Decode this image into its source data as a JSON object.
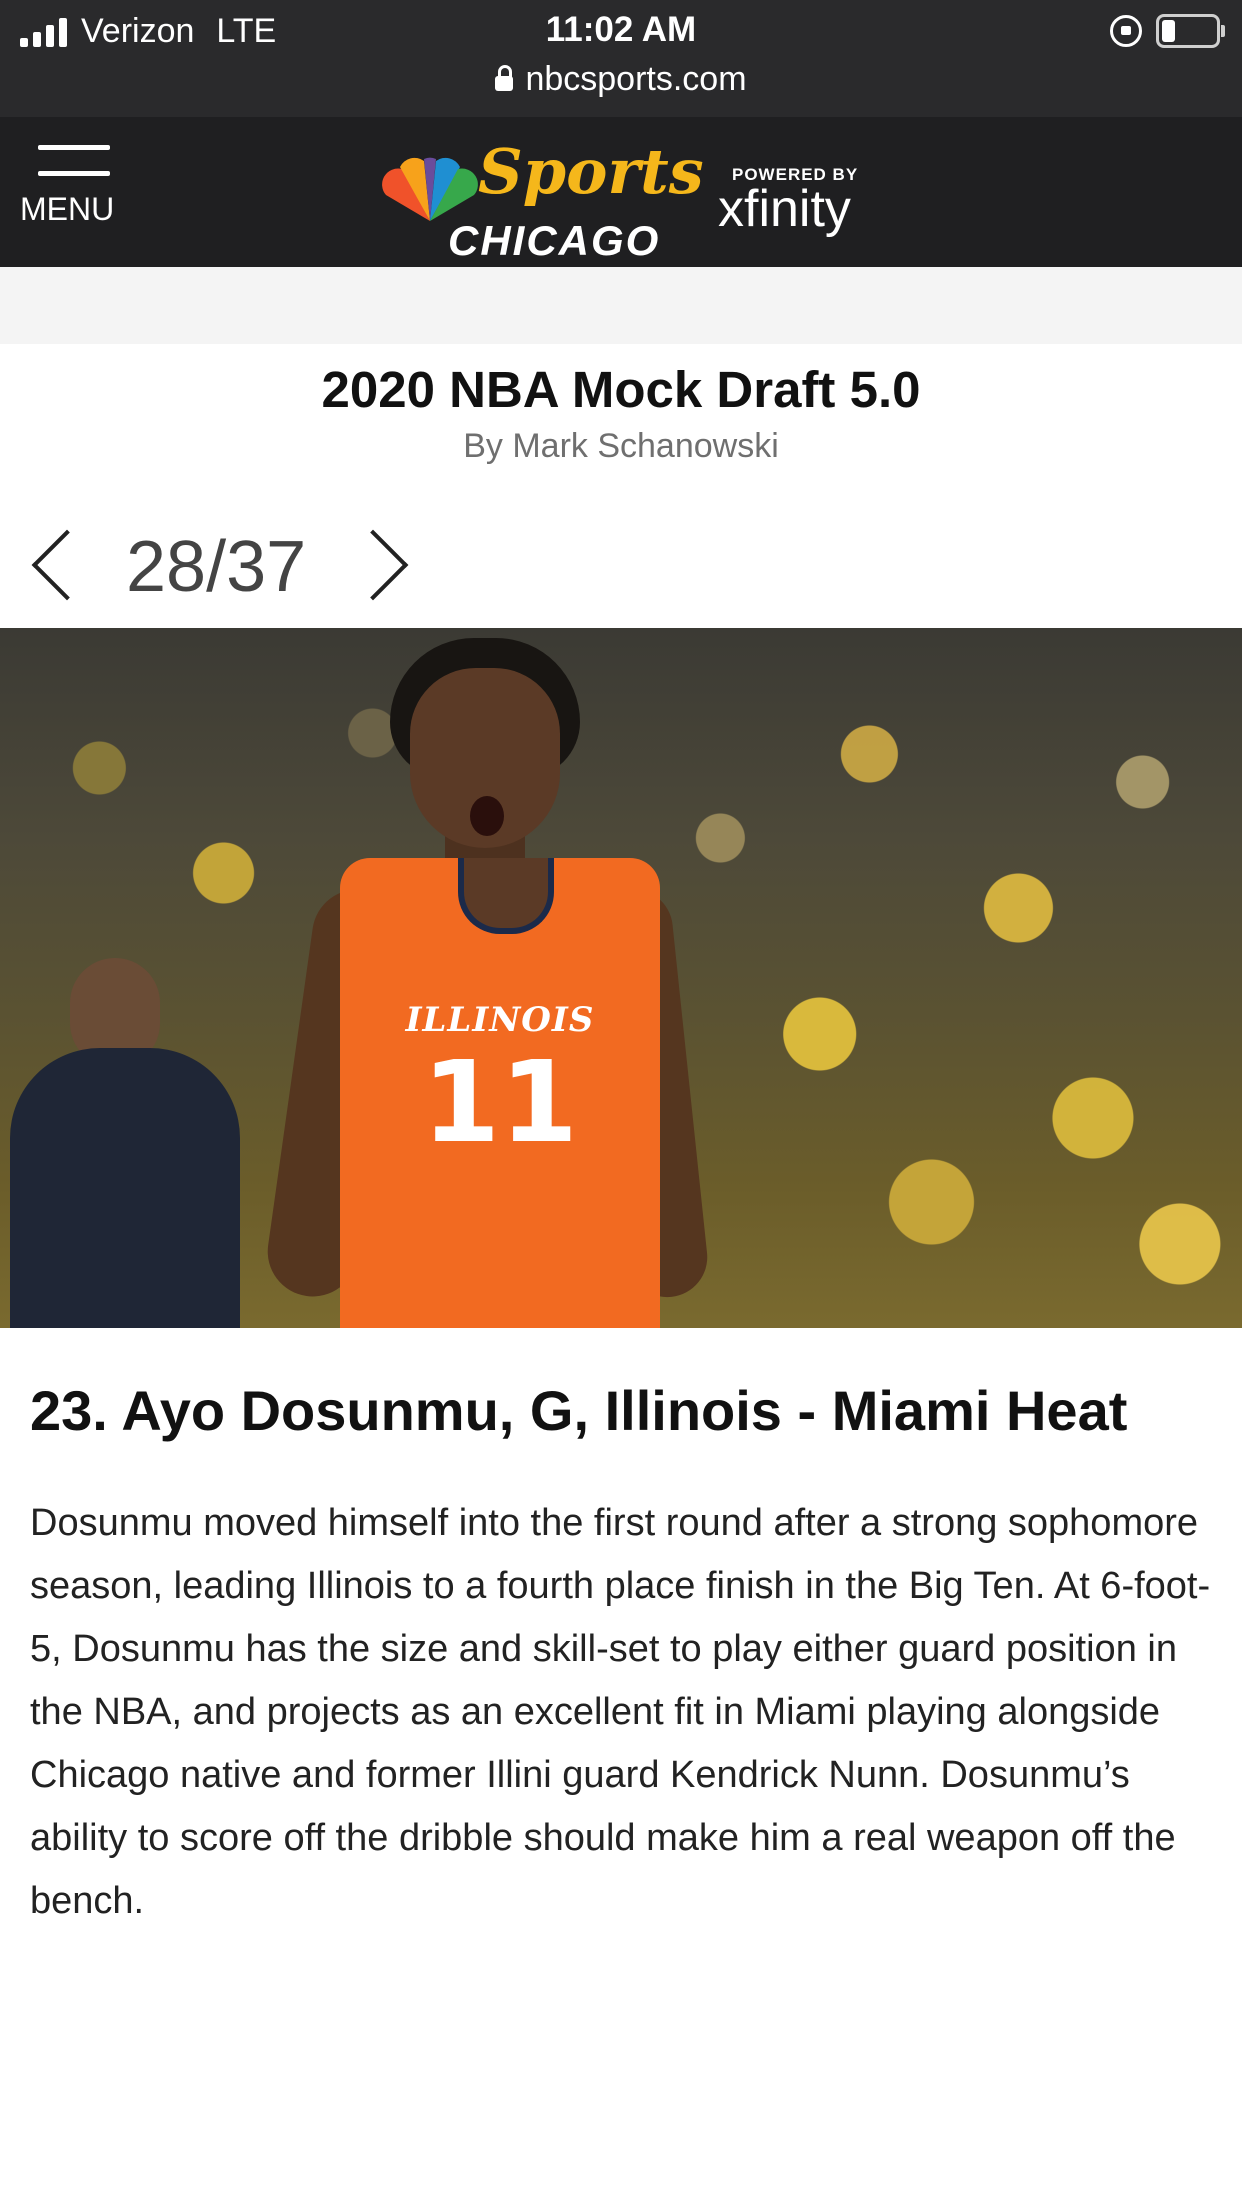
{
  "status_bar": {
    "carrier": "Verizon",
    "network": "LTE",
    "time": "11:02 AM",
    "url": "nbcsports.com",
    "icons": [
      "signal-icon",
      "lock-icon",
      "rotation-lock-icon",
      "battery-icon"
    ],
    "battery_level": 0.25
  },
  "header": {
    "menu_label": "MENU",
    "logo_script": "Sports",
    "logo_city": "CHICAGO",
    "powered_by": "POWERED BY",
    "sponsor": "xfinity",
    "logo_accent": "#f5b71b"
  },
  "article": {
    "title": "2020 NBA Mock Draft 5.0",
    "byline": "By Mark Schanowski",
    "pager": {
      "current": "28/37"
    },
    "photo": {
      "jersey_team": "ILLINOIS",
      "jersey_number": "11"
    },
    "headline": "23. Ayo Dosunmu, G, Illinois - Miami Heat",
    "body": "Dosunmu moved himself into the first round after a strong sophomore season, leading Illinois to a fourth place finish in the Big Ten. At 6-foot-5, Dosunmu has the size and skill-set to play either guard position in the NBA, and projects as an excellent fit in Miami playing alongside Chicago native and former Illini guard Kendrick Nunn. Dosunmu’s ability to score off the dribble should make him a real weapon off the bench."
  }
}
